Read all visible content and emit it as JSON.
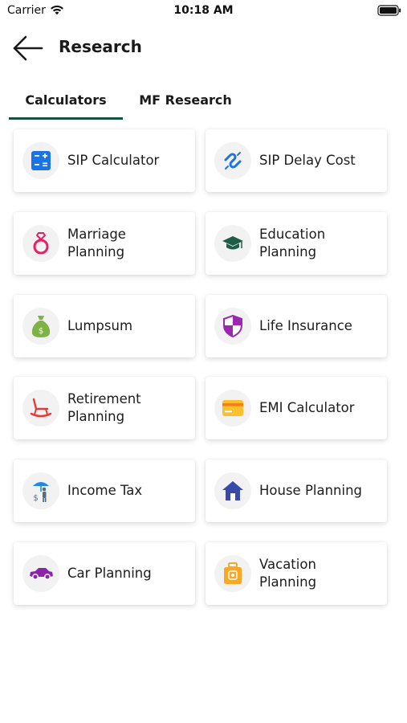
{
  "status_bar": {
    "carrier": "Carrier",
    "time": "10:18 AM",
    "icons": [
      "wifi-icon",
      "battery-icon"
    ]
  },
  "header": {
    "back_icon": "arrow-left-icon",
    "title": "Research"
  },
  "tabs": [
    {
      "label": "Calculators",
      "active": true
    },
    {
      "label": "MF Research",
      "active": false
    }
  ],
  "accent_color": "#12543f",
  "cards": [
    {
      "line1": "SIP Calculator",
      "line2": "",
      "icon": "calculator-icon",
      "color": "#1a73e8"
    },
    {
      "line1": "SIP Delay Cost",
      "line2": "",
      "icon": "broken-link-icon",
      "color": "#1a73e8"
    },
    {
      "line1": "Marriage",
      "line2": "Planning",
      "icon": "ring-icon",
      "color": "#e91e63"
    },
    {
      "line1": "Education",
      "line2": "Planning",
      "icon": "graduation-cap-icon",
      "color": "#1e5e46"
    },
    {
      "line1": "Lumpsum",
      "line2": "",
      "icon": "money-bag-icon",
      "color": "#7cb342"
    },
    {
      "line1": "Life Insurance",
      "line2": "",
      "icon": "shield-icon",
      "color": "#9c27b0"
    },
    {
      "line1": "Retirement",
      "line2": "Planning",
      "icon": "rocking-chair-icon",
      "color": "#e53935"
    },
    {
      "line1": "EMI Calculator",
      "line2": "",
      "icon": "credit-card-icon",
      "color": "#fbc02d"
    },
    {
      "line1": "Income Tax",
      "line2": "",
      "icon": "person-umbrella-icon",
      "color": "#546e7a"
    },
    {
      "line1": "House Planning",
      "line2": "",
      "icon": "house-icon",
      "color": "#3949ab"
    },
    {
      "line1": "Car Planning",
      "line2": "",
      "icon": "car-icon",
      "color": "#8e24aa"
    },
    {
      "line1": "Vacation",
      "line2": "Planning",
      "icon": "suitcase-icon",
      "color": "#f9a825"
    }
  ]
}
